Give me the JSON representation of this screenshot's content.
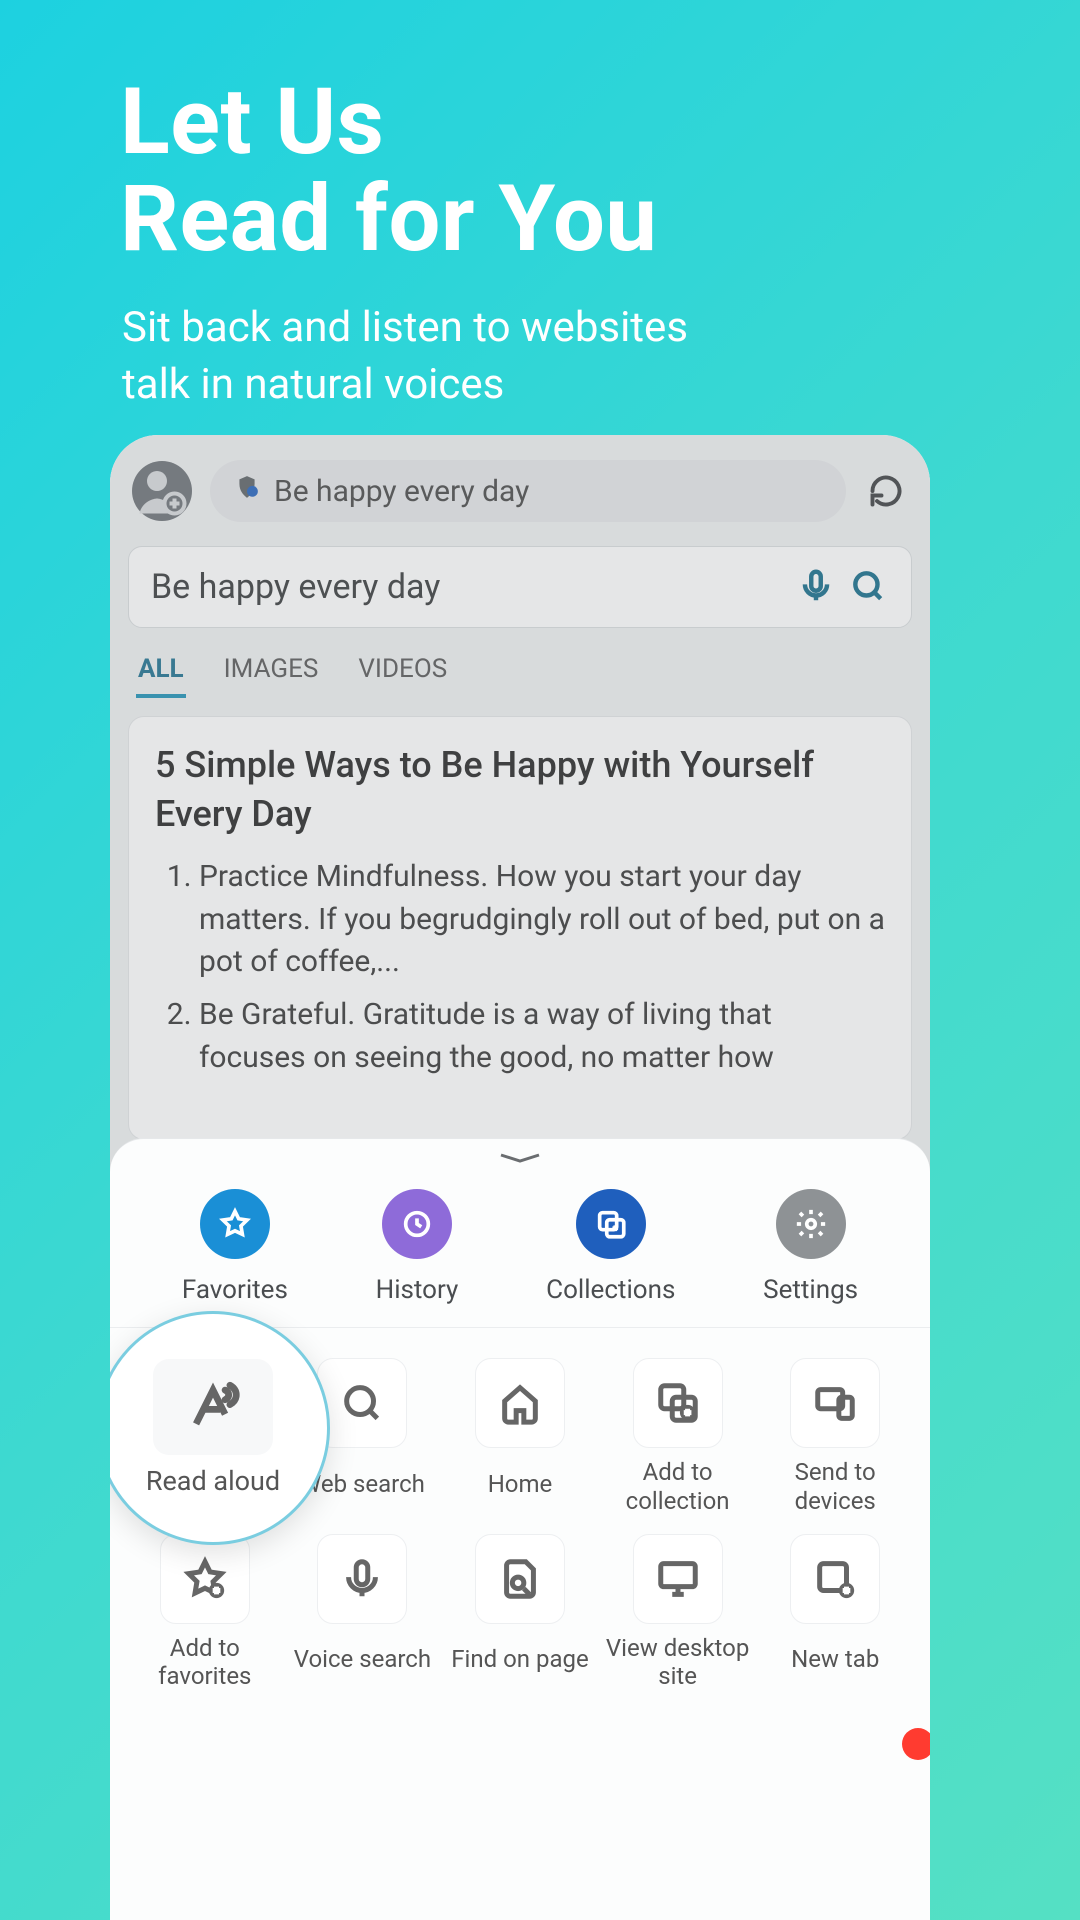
{
  "promo": {
    "title_line1": "Let Us",
    "title_line2": "Read for You",
    "subtitle_line1": "Sit back and listen to websites",
    "subtitle_line2": "talk in natural voices"
  },
  "browser": {
    "url_text": "Be happy every day",
    "search_value": "Be happy every day",
    "tabs": {
      "all": "ALL",
      "images": "IMAGES",
      "videos": "VIDEOS"
    },
    "result": {
      "title": "5 Simple Ways to Be Happy with Yourself Every Day",
      "item1": "Practice Mindfulness. How you start your day matters. If you begrudgingly roll out of bed, put on a pot of coffee,...",
      "item2": "Be Grateful. Gratitude is a way of living that focuses on seeing the good, no matter how"
    }
  },
  "drawer": {
    "row1": {
      "favorites": "Favorites",
      "history": "History",
      "collections": "Collections",
      "settings": "Settings"
    },
    "highlight": "Read aloud",
    "grid": {
      "web_search": "Web search",
      "home": "Home",
      "add_collection": "Add to collection",
      "send_devices": "Send to devices",
      "add_favorites": "Add to favorites",
      "voice_search": "Voice search",
      "find_page": "Find on page",
      "desktop_site": "View desktop site",
      "new_tab": "New tab"
    }
  }
}
